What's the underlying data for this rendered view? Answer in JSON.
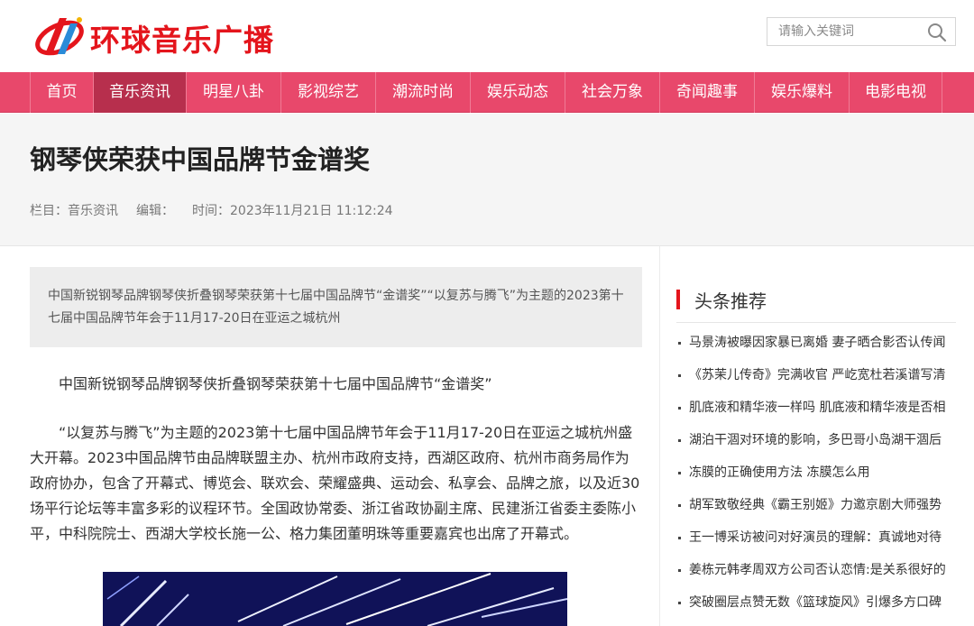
{
  "header": {
    "site_name": "环球音乐广播",
    "search_placeholder": "请输入关键词"
  },
  "nav": {
    "items": [
      {
        "label": "首页"
      },
      {
        "label": "音乐资讯"
      },
      {
        "label": "明星八卦"
      },
      {
        "label": "影视综艺"
      },
      {
        "label": "潮流时尚"
      },
      {
        "label": "娱乐动态"
      },
      {
        "label": "社会万象"
      },
      {
        "label": "奇闻趣事"
      },
      {
        "label": "娱乐爆料"
      },
      {
        "label": "电影电视"
      }
    ],
    "active_label": "音乐资讯"
  },
  "article": {
    "title": "钢琴侠荣获中国品牌节金谱奖",
    "meta_column": "栏目：音乐资讯",
    "meta_editor": "编辑：",
    "meta_time": "时间：2023年11月21日 11:12:24",
    "summary": "中国新锐钢琴品牌钢琴侠折叠钢琴荣获第十七届中国品牌节“金谱奖”“以复苏与腾飞”为主题的2023第十七届中国品牌节年会于11月17-20日在亚运之城杭州",
    "paragraph1": "中国新锐钢琴品牌钢琴侠折叠钢琴荣获第十七届中国品牌节“金谱奖”",
    "paragraph2": "“以复苏与腾飞”为主题的2023第十七届中国品牌节年会于11月17-20日在亚运之城杭州盛大开幕。2023中国品牌节由品牌联盟主办、杭州市政府支持，西湖区政府、杭州市商务局作为政府协办，包含了开幕式、博览会、联欢会、荣耀盛典、运动会、私享会、品牌之旅，以及近30场平行论坛等丰富多彩的议程环节。全国政协常委、浙江省政协副主席、民建浙江省委主委陈小平，中科院院士、西湖大学校长施一公、格力集团董明珠等重要嘉宾也出席了开幕式。"
  },
  "sidebar": {
    "title": "头条推荐",
    "items": [
      "马景涛被曝因家暴已离婚 妻子晒合影否认传闻",
      "《苏茉儿传奇》完满收官 严屹宽杜若溪谱写清",
      "肌底液和精华液一样吗 肌底液和精华液是否相",
      "湖泊干涸对环境的影响，多巴哥小岛湖干涸后",
      "冻膜的正确使用方法 冻膜怎么用",
      "胡军致敬经典《霸王别姬》力邀京剧大师强势",
      "王一博采访被问对好演员的理解：真诚地对待",
      "姜栋元韩孝周双方公司否认恋情:是关系很好的",
      "突破圈层点赞无数《篮球旋风》引爆多方口碑"
    ]
  },
  "colors": {
    "brand_red": "#e4151c",
    "nav_pink": "#e8486b",
    "nav_active": "#b72f4d"
  }
}
